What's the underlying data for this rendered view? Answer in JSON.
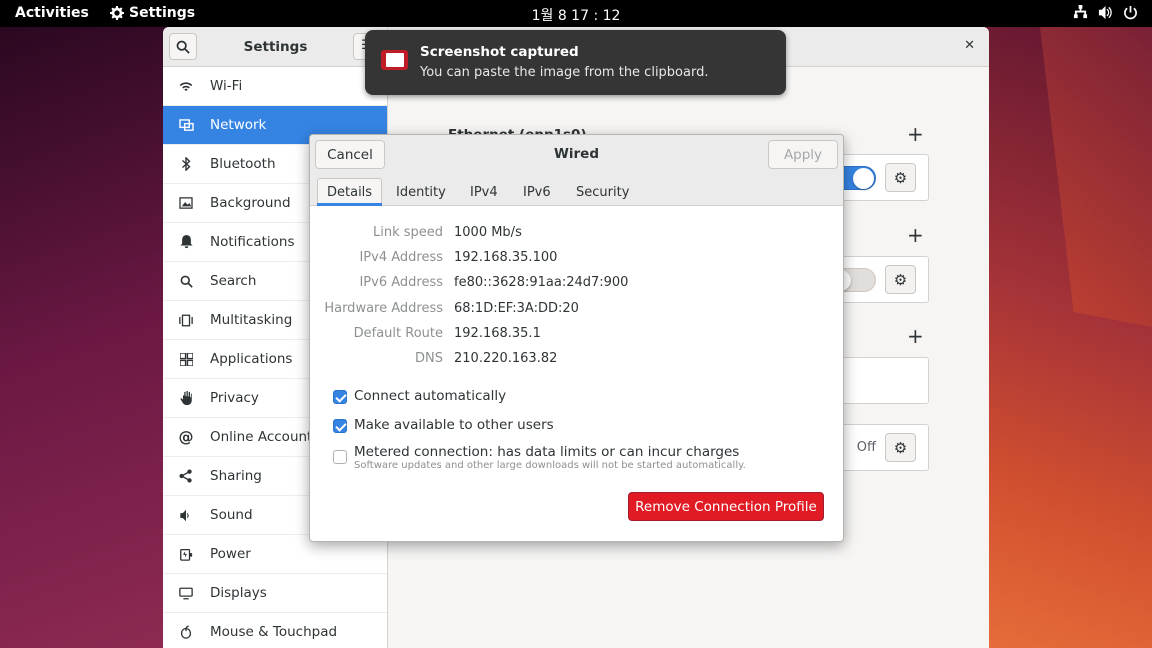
{
  "topbar": {
    "activities": "Activities",
    "app_name": "Settings",
    "clock": "1월 8  17 : 12"
  },
  "settings": {
    "title": "Settings",
    "sidebar": {
      "items": [
        {
          "label": "Wi-Fi",
          "icon": "wifi-icon"
        },
        {
          "label": "Network",
          "icon": "network-icon",
          "active": true
        },
        {
          "label": "Bluetooth",
          "icon": "bluetooth-icon"
        },
        {
          "label": "Background",
          "icon": "background-icon"
        },
        {
          "label": "Notifications",
          "icon": "bell-icon"
        },
        {
          "label": "Search",
          "icon": "search-icon"
        },
        {
          "label": "Multitasking",
          "icon": "multitasking-icon"
        },
        {
          "label": "Applications",
          "icon": "applications-icon"
        },
        {
          "label": "Privacy",
          "icon": "hand-icon"
        },
        {
          "label": "Online Accounts",
          "icon": "at-icon"
        },
        {
          "label": "Sharing",
          "icon": "share-icon"
        },
        {
          "label": "Sound",
          "icon": "speaker-icon"
        },
        {
          "label": "Power",
          "icon": "power-plug-icon"
        },
        {
          "label": "Displays",
          "icon": "display-icon"
        },
        {
          "label": "Mouse & Touchpad",
          "icon": "mouse-icon"
        }
      ]
    },
    "content": {
      "ethernet_title": "Ethernet (enp1s0)",
      "proxy_state": "Off"
    }
  },
  "notification": {
    "title": "Screenshot captured",
    "body": "You can paste the image from the clipboard."
  },
  "dialog": {
    "title": "Wired",
    "cancel": "Cancel",
    "apply": "Apply",
    "tabs": [
      "Details",
      "Identity",
      "IPv4",
      "IPv6",
      "Security"
    ],
    "details": [
      {
        "label": "Link speed",
        "value": "1000 Mb/s"
      },
      {
        "label": "IPv4 Address",
        "value": "192.168.35.100"
      },
      {
        "label": "IPv6 Address",
        "value": "fe80::3628:91aa:24d7:900"
      },
      {
        "label": "Hardware Address",
        "value": "68:1D:EF:3A:DD:20"
      },
      {
        "label": "Default Route",
        "value": "192.168.35.1"
      },
      {
        "label": "DNS",
        "value": "210.220.163.82"
      }
    ],
    "connect_auto": "Connect automatically",
    "available_all": "Make available to other users",
    "metered": "Metered connection: has data limits or can incur charges",
    "metered_sub": "Software updates and other large downloads will not be started automatically.",
    "remove": "Remove Connection Profile"
  },
  "colors": {
    "accent": "#3584e4",
    "destructive": "#e01b24"
  }
}
